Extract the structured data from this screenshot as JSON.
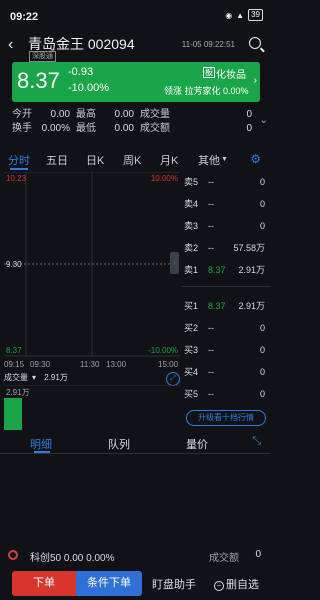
{
  "status": {
    "time": "09:22",
    "battery": "39"
  },
  "header": {
    "name_code": "青岛金王 002094",
    "exchange": "深股通",
    "time": "11-05 09:22:51"
  },
  "quote": {
    "price": "8.37",
    "change": "-0.93",
    "change_pct": "-10.00%",
    "sector": "化妆品",
    "leader": "领涨 拉芳家化 0.00%"
  },
  "stats": {
    "row1": [
      {
        "k": "今开",
        "v": "0.00"
      },
      {
        "k": "最高",
        "v": "0.00"
      },
      {
        "k": "成交量",
        "v": "0"
      }
    ],
    "row2": [
      {
        "k": "换手",
        "v": "0.00%"
      },
      {
        "k": "最低",
        "v": "0.00"
      },
      {
        "k": "成交额",
        "v": "0"
      }
    ]
  },
  "tabs": [
    "分时",
    "五日",
    "日K",
    "周K",
    "月K",
    "其他"
  ],
  "chart_data": {
    "type": "line",
    "y_top_left": "10.23",
    "y_mid": "9.30",
    "y_bottom_left": "8.37",
    "y_top_right": "10.00%",
    "y_bottom_right": "-10.00%",
    "x_ticks": [
      "09:15",
      "09:30",
      "11:30",
      "13:00",
      "15:00"
    ],
    "ylim": [
      8.37,
      10.23
    ]
  },
  "volume": {
    "label": "成交量",
    "value": "2.91万",
    "axis": "2.91万"
  },
  "orderbook": {
    "asks": [
      {
        "label": "卖5",
        "price": "--",
        "qty": "0"
      },
      {
        "label": "卖4",
        "price": "--",
        "qty": "0"
      },
      {
        "label": "卖3",
        "price": "--",
        "qty": "0"
      },
      {
        "label": "卖2",
        "price": "--",
        "qty": "57.58万"
      },
      {
        "label": "卖1",
        "price": "8.37",
        "qty": "2.91万"
      }
    ],
    "bids": [
      {
        "label": "买1",
        "price": "8.37",
        "qty": "2.91万"
      },
      {
        "label": "买2",
        "price": "--",
        "qty": "0"
      },
      {
        "label": "买3",
        "price": "--",
        "qty": "0"
      },
      {
        "label": "买4",
        "price": "--",
        "qty": "0"
      },
      {
        "label": "买5",
        "price": "--",
        "qty": "0"
      }
    ],
    "upgrade": "升级看十档行情"
  },
  "bottom_tabs": [
    "明细",
    "队列",
    "量价"
  ],
  "ticker": {
    "name": "科创50",
    "value": "0.00 0.00%",
    "turnover_label": "成交额",
    "turnover_value": "0"
  },
  "bottombar": {
    "sell": "下单",
    "cond": "条件下单",
    "watch": "盯盘助手",
    "del": "删自选"
  },
  "colors": {
    "green": "#1aa548",
    "red": "#d8352f",
    "blue": "#2f7be0"
  }
}
